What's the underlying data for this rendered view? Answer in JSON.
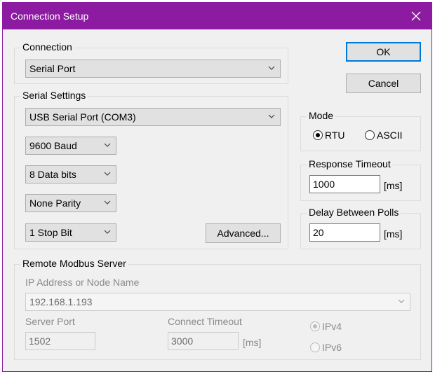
{
  "window": {
    "title": "Connection Setup"
  },
  "buttons": {
    "ok": "OK",
    "cancel": "Cancel",
    "advanced": "Advanced..."
  },
  "connection": {
    "label": "Connection",
    "selected": "Serial Port"
  },
  "serial": {
    "label": "Serial Settings",
    "port": "USB Serial Port (COM3)",
    "baud": "9600 Baud",
    "data_bits": "8 Data bits",
    "parity": "None Parity",
    "stop_bits": "1 Stop Bit"
  },
  "mode": {
    "label": "Mode",
    "rtu": "RTU",
    "ascii": "ASCII",
    "selected": "RTU"
  },
  "response_timeout": {
    "label": "Response Timeout",
    "value": "1000",
    "unit": "[ms]"
  },
  "delay_polls": {
    "label": "Delay Between Polls",
    "value": "20",
    "unit": "[ms]"
  },
  "remote": {
    "label": "Remote Modbus Server",
    "ip_label": "IP Address or Node Name",
    "ip_value": "192.168.1.193",
    "port_label": "Server Port",
    "port_value": "1502",
    "timeout_label": "Connect Timeout",
    "timeout_value": "3000",
    "timeout_unit": "[ms]",
    "ipv4": "IPv4",
    "ipv6": "IPv6",
    "ip_selected": "IPv4"
  },
  "colors": {
    "titlebar": "#8c1ba1",
    "focus": "#0078d7"
  }
}
